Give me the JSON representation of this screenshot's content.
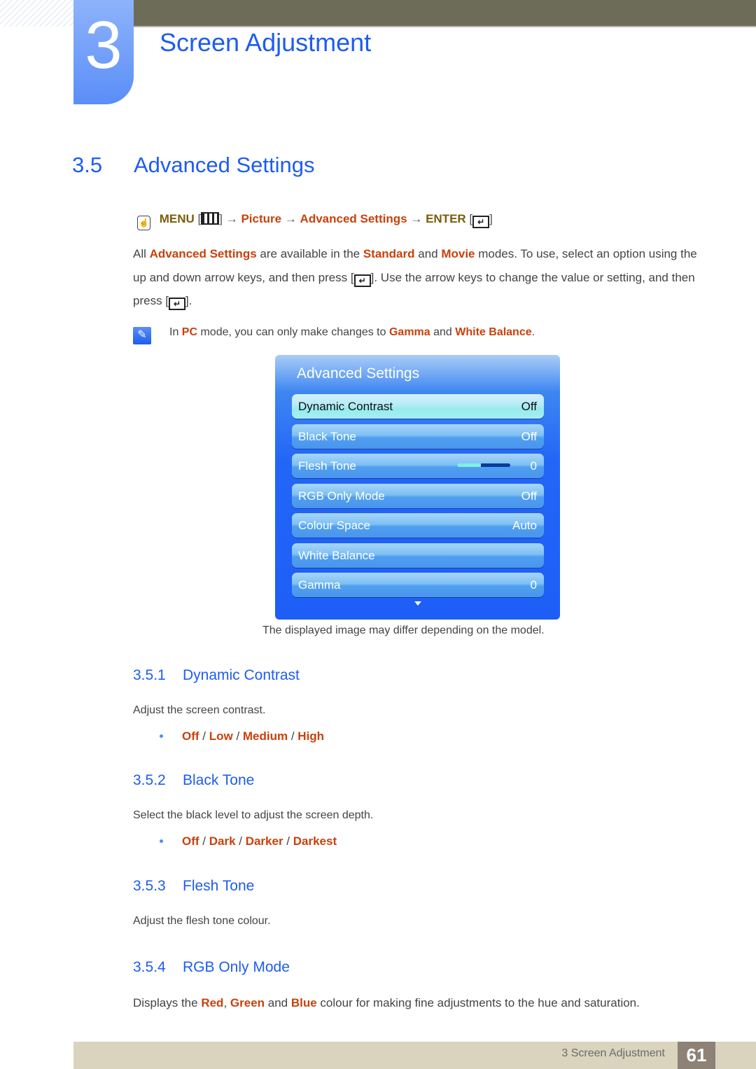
{
  "chapter": {
    "number": "3",
    "title": "Screen Adjustment"
  },
  "section": {
    "number": "3.5",
    "title": "Advanced Settings"
  },
  "menu_path": {
    "menu": "MENU",
    "arrow": "→",
    "picture": "Picture",
    "advanced": "Advanced Settings",
    "enter": "ENTER",
    "icons": [
      "remote-hand-icon",
      "menu-icon",
      "enter-icon"
    ]
  },
  "intro": {
    "t1": "All ",
    "h1": "Advanced Settings",
    "t2": " are available in the ",
    "h2": "Standard",
    "t3": " and ",
    "h3": "Movie",
    "t4": " modes. To use, select an option using the up and down arrow keys, and then press [",
    "t5": "]. Use the arrow keys to change the value or setting, and then press [",
    "t6": "]."
  },
  "note": {
    "icon": "note-pencil-icon",
    "t1": "In ",
    "h1": "PC",
    "t2": " mode, you can only make changes to ",
    "h2": "Gamma",
    "t3": " and ",
    "h3": "White Balance",
    "t4": "."
  },
  "osd": {
    "title": "Advanced Settings",
    "items": [
      {
        "label": "Dynamic Contrast",
        "value": "Off",
        "selected": true
      },
      {
        "label": "Black Tone",
        "value": "Off"
      },
      {
        "label": "Flesh Tone",
        "value": "0",
        "slider_fraction": 0.45
      },
      {
        "label": "RGB Only Mode",
        "value": "Off"
      },
      {
        "label": "Colour Space",
        "value": "Auto"
      },
      {
        "label": "White Balance",
        "value": ""
      },
      {
        "label": "Gamma",
        "value": "0"
      }
    ],
    "more_icon": "scroll-down-arrow-icon"
  },
  "caption": "The displayed image may differ depending on the model.",
  "subsections": [
    {
      "number": "3.5.1",
      "title": "Dynamic Contrast",
      "description": "Adjust the screen contrast.",
      "options": [
        "Off",
        "Low",
        "Medium",
        "High"
      ]
    },
    {
      "number": "3.5.2",
      "title": "Black Tone",
      "description": "Select the black level to adjust the screen depth.",
      "options": [
        "Off",
        "Dark",
        "Darker",
        "Darkest"
      ]
    },
    {
      "number": "3.5.3",
      "title": "Flesh Tone",
      "description": "Adjust the flesh tone colour."
    },
    {
      "number": "3.5.4",
      "title": "RGB Only Mode",
      "d1": "Displays the ",
      "red": "Red",
      "comma": ", ",
      "green": "Green",
      "and": " and ",
      "blue": "Blue",
      "d2": " colour for making fine adjustments to the hue and saturation."
    }
  ],
  "option_separator": " / ",
  "footer": {
    "label": "3 Screen Adjustment",
    "page": "61"
  },
  "colors": {
    "heading_blue": "#1e5cf0",
    "highlight_orange": "#c8410b",
    "menu_olive": "#7b5c0c",
    "osd_blue": "#1e5ef7",
    "footer_bg": "#dad3be",
    "top_bar": "#6d6c59"
  }
}
